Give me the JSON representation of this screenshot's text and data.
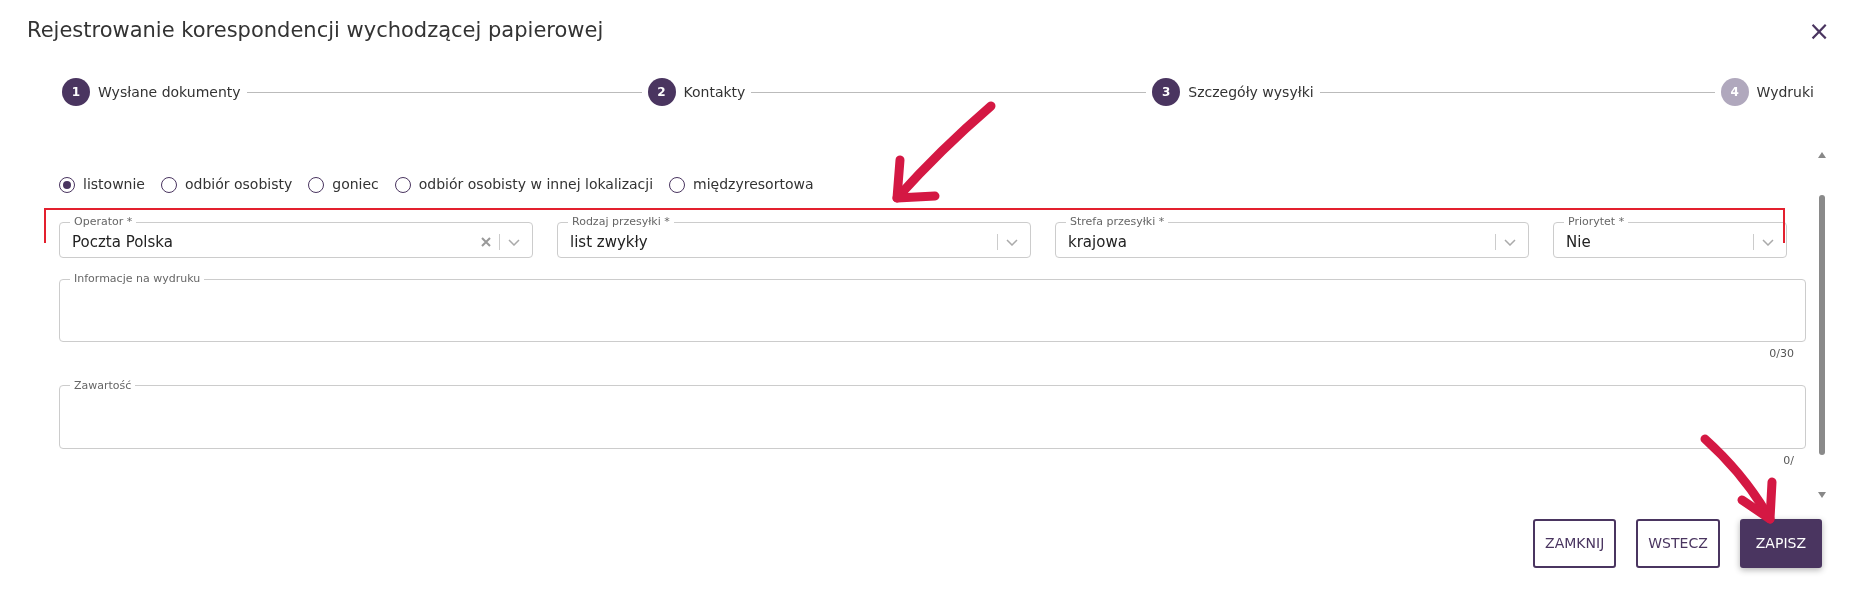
{
  "window": {
    "title": "Rejestrowanie korespondencji wychodzącej papierowej",
    "close": "×"
  },
  "steps": [
    {
      "number": "1",
      "label": "Wysłane dokumenty",
      "reached": true
    },
    {
      "number": "2",
      "label": "Kontakty",
      "reached": true
    },
    {
      "number": "3",
      "label": "Szczegóły wysyłki",
      "reached": true
    },
    {
      "number": "4",
      "label": "Wydruki",
      "reached": false
    }
  ],
  "delivery_methods": [
    {
      "label": "listownie",
      "selected": true
    },
    {
      "label": "odbiór osobisty",
      "selected": false
    },
    {
      "label": "goniec",
      "selected": false
    },
    {
      "label": "odbiór osobisty w innej lokalizacji",
      "selected": false
    },
    {
      "label": "międzyresortowa",
      "selected": false
    }
  ],
  "selects": [
    {
      "label": "Operator *",
      "value": "Poczta Polska",
      "clearable": true
    },
    {
      "label": "Rodzaj przesyłki *",
      "value": "list zwykły",
      "clearable": false
    },
    {
      "label": "Strefa przesyłki *",
      "value": "krajowa",
      "clearable": false
    },
    {
      "label": "Priorytet *",
      "value": "Nie",
      "clearable": false
    }
  ],
  "text_areas": [
    {
      "label": "Informacje na wydruku",
      "counter": "0/30"
    },
    {
      "label": "Zawartość",
      "counter": "0/"
    }
  ],
  "buttons": [
    {
      "label": "ZAMKNIJ",
      "primary": false
    },
    {
      "label": "WSTECZ",
      "primary": false
    },
    {
      "label": "ZAPISZ",
      "primary": true
    }
  ],
  "annotations": [
    {
      "kind": "frame"
    },
    {
      "kind": "arrow"
    },
    {
      "kind": "arrow"
    }
  ]
}
